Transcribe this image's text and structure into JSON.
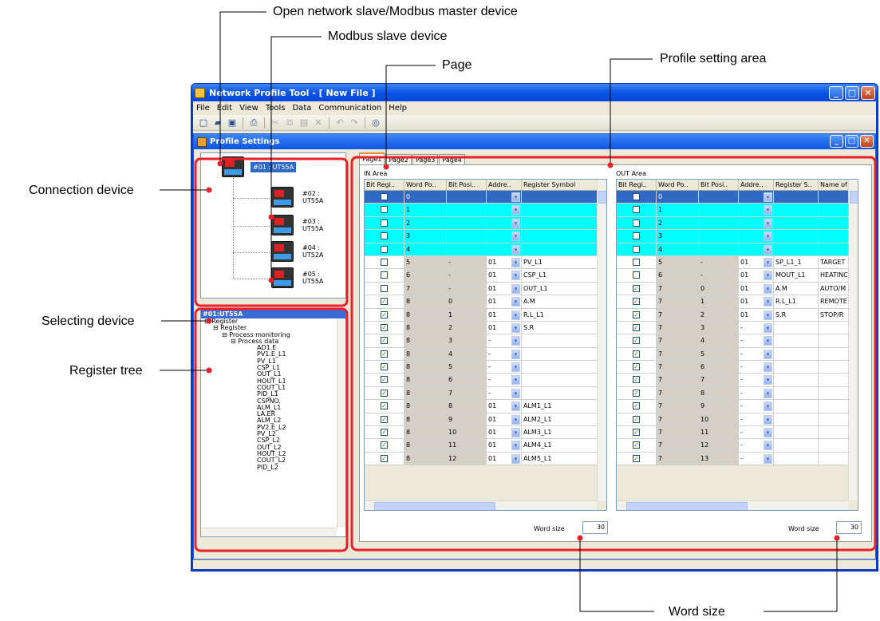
{
  "callouts": {
    "open_network": "Open network slave/Modbus master device",
    "modbus_slave": "Modbus slave device",
    "page": "Page",
    "profile_area": "Profile setting area",
    "connection_device": "Connection device",
    "selecting_device": "Selecting device",
    "register_tree": "Register tree",
    "word_size": "Word size"
  },
  "app": {
    "title": "Network Profile Tool - [ New File ]",
    "menu": [
      "File",
      "Edit",
      "View",
      "Tools",
      "Data",
      "Communication",
      "Help"
    ],
    "child_title": "Profile Settings",
    "toolbar_icons": [
      "new-icon",
      "open-icon",
      "save-icon",
      "print-icon",
      "cut-icon",
      "copy-icon",
      "paste-icon",
      "delete-icon",
      "undo-icon",
      "redo-icon",
      "help-icon"
    ]
  },
  "devices": [
    {
      "label": "#01 : UT55A",
      "selected": true
    },
    {
      "label": "#02 : UT55A"
    },
    {
      "label": "#03 : UT55A"
    },
    {
      "label": "#04 : UT52A"
    },
    {
      "label": "#05 : UT55A"
    }
  ],
  "register_panel": {
    "header": "#01:UT55A",
    "nodes": [
      {
        "t": "Register",
        "lvl": 0,
        "exp": true
      },
      {
        "t": "Register",
        "lvl": 1,
        "exp": true
      },
      {
        "t": "Process monitoring",
        "lvl": 2,
        "exp": true
      },
      {
        "t": "Process data",
        "lvl": 3,
        "exp": true
      },
      {
        "t": "AD1.E",
        "lvl": 4
      },
      {
        "t": "PV1.E_L1",
        "lvl": 4
      },
      {
        "t": "PV_L1",
        "lvl": 4
      },
      {
        "t": "CSP_L1",
        "lvl": 4
      },
      {
        "t": "OUT_L1",
        "lvl": 4
      },
      {
        "t": "HOUT_L1",
        "lvl": 4
      },
      {
        "t": "COUT_L1",
        "lvl": 4
      },
      {
        "t": "PID_L1",
        "lvl": 4
      },
      {
        "t": "CSPNO.",
        "lvl": 4
      },
      {
        "t": "ALM_L1",
        "lvl": 4
      },
      {
        "t": "LA.ER",
        "lvl": 4
      },
      {
        "t": "ALM_L2",
        "lvl": 4
      },
      {
        "t": "PV2.E_L2",
        "lvl": 4
      },
      {
        "t": "PV_L2",
        "lvl": 4
      },
      {
        "t": "CSP_L2",
        "lvl": 4
      },
      {
        "t": "OUT_L2",
        "lvl": 4
      },
      {
        "t": "HOUT_L2",
        "lvl": 4
      },
      {
        "t": "COUT_L2",
        "lvl": 4
      },
      {
        "t": "PID_L2",
        "lvl": 4
      }
    ]
  },
  "tabs": [
    "Page1",
    "Page2",
    "Page3",
    "Page4"
  ],
  "in_area": {
    "label": "IN Area",
    "headers": [
      "Bit Regi..",
      "Word Po..",
      "Bit Posi..",
      "Addre..",
      "Register Symbol"
    ],
    "rows": [
      {
        "c": false,
        "w": "0",
        "b": "",
        "a": "",
        "s": "",
        "st": "sel"
      },
      {
        "c": false,
        "w": "1",
        "b": "",
        "a": "",
        "s": "",
        "st": "cyan"
      },
      {
        "c": false,
        "w": "2",
        "b": "",
        "a": "",
        "s": "",
        "st": "cyan"
      },
      {
        "c": false,
        "w": "3",
        "b": "",
        "a": "",
        "s": "",
        "st": "cyan"
      },
      {
        "c": false,
        "w": "4",
        "b": "",
        "a": "",
        "s": "",
        "st": "cyan"
      },
      {
        "c": false,
        "w": "5",
        "b": "-",
        "a": "01",
        "s": "PV_L1"
      },
      {
        "c": false,
        "w": "6",
        "b": "-",
        "a": "01",
        "s": "CSP_L1"
      },
      {
        "c": false,
        "w": "7",
        "b": "-",
        "a": "01",
        "s": "OUT_L1"
      },
      {
        "c": true,
        "w": "8",
        "b": "0",
        "a": "01",
        "s": "A.M"
      },
      {
        "c": true,
        "w": "8",
        "b": "1",
        "a": "01",
        "s": "R.L_L1"
      },
      {
        "c": true,
        "w": "8",
        "b": "2",
        "a": "01",
        "s": "S.R"
      },
      {
        "c": true,
        "w": "8",
        "b": "3",
        "a": "-",
        "s": ""
      },
      {
        "c": true,
        "w": "8",
        "b": "4",
        "a": "-",
        "s": ""
      },
      {
        "c": true,
        "w": "8",
        "b": "5",
        "a": "-",
        "s": ""
      },
      {
        "c": true,
        "w": "8",
        "b": "6",
        "a": "-",
        "s": ""
      },
      {
        "c": true,
        "w": "8",
        "b": "7",
        "a": "-",
        "s": ""
      },
      {
        "c": true,
        "w": "8",
        "b": "8",
        "a": "01",
        "s": "ALM1_L1"
      },
      {
        "c": true,
        "w": "8",
        "b": "9",
        "a": "01",
        "s": "ALM2_L1"
      },
      {
        "c": true,
        "w": "8",
        "b": "10",
        "a": "01",
        "s": "ALM3_L1"
      },
      {
        "c": true,
        "w": "8",
        "b": "11",
        "a": "01",
        "s": "ALM4_L1"
      },
      {
        "c": true,
        "w": "8",
        "b": "12",
        "a": "01",
        "s": "ALM5_L1"
      }
    ],
    "word_size_label": "Word size",
    "word_size": "30"
  },
  "out_area": {
    "label": "OUT Area",
    "headers": [
      "Bit Regi..",
      "Word Po..",
      "Bit Posi..",
      "Addre..",
      "Register S..",
      "Name of"
    ],
    "rows": [
      {
        "c": false,
        "w": "0",
        "b": "",
        "a": "",
        "s": "",
        "n": "",
        "st": "sel"
      },
      {
        "c": false,
        "w": "1",
        "b": "",
        "a": "",
        "s": "",
        "n": "",
        "st": "cyan"
      },
      {
        "c": false,
        "w": "2",
        "b": "",
        "a": "",
        "s": "",
        "n": "",
        "st": "cyan"
      },
      {
        "c": false,
        "w": "3",
        "b": "",
        "a": "",
        "s": "",
        "n": "",
        "st": "cyan"
      },
      {
        "c": false,
        "w": "4",
        "b": "",
        "a": "",
        "s": "",
        "n": "",
        "st": "cyan"
      },
      {
        "c": false,
        "w": "5",
        "b": "-",
        "a": "01",
        "s": "SP_L1_1",
        "n": "TARGET"
      },
      {
        "c": false,
        "w": "6",
        "b": "-",
        "a": "01",
        "s": "MOUT_L1",
        "n": "HEATINC"
      },
      {
        "c": true,
        "w": "7",
        "b": "0",
        "a": "01",
        "s": "A.M",
        "n": "AUTO/M"
      },
      {
        "c": true,
        "w": "7",
        "b": "1",
        "a": "01",
        "s": "R.L_L1",
        "n": "REMOTE"
      },
      {
        "c": true,
        "w": "7",
        "b": "2",
        "a": "01",
        "s": "S.R",
        "n": "STOP/R"
      },
      {
        "c": true,
        "w": "7",
        "b": "3",
        "a": "-",
        "s": "",
        "n": ""
      },
      {
        "c": true,
        "w": "7",
        "b": "4",
        "a": "-",
        "s": "",
        "n": ""
      },
      {
        "c": true,
        "w": "7",
        "b": "5",
        "a": "-",
        "s": "",
        "n": ""
      },
      {
        "c": true,
        "w": "7",
        "b": "6",
        "a": "-",
        "s": "",
        "n": ""
      },
      {
        "c": true,
        "w": "7",
        "b": "7",
        "a": "-",
        "s": "",
        "n": ""
      },
      {
        "c": true,
        "w": "7",
        "b": "8",
        "a": "-",
        "s": "",
        "n": ""
      },
      {
        "c": true,
        "w": "7",
        "b": "9",
        "a": "-",
        "s": "",
        "n": ""
      },
      {
        "c": true,
        "w": "7",
        "b": "10",
        "a": "-",
        "s": "",
        "n": ""
      },
      {
        "c": true,
        "w": "7",
        "b": "11",
        "a": "-",
        "s": "",
        "n": ""
      },
      {
        "c": true,
        "w": "7",
        "b": "12",
        "a": "-",
        "s": "",
        "n": ""
      },
      {
        "c": true,
        "w": "7",
        "b": "13",
        "a": "-",
        "s": "",
        "n": ""
      }
    ],
    "word_size_label": "Word size",
    "word_size": "30"
  },
  "colors": {
    "highlight": "#e8202a",
    "selected_row": "#316ac5",
    "cyan_row": "#00ffff",
    "gray_cell": "#d4d0c8"
  }
}
